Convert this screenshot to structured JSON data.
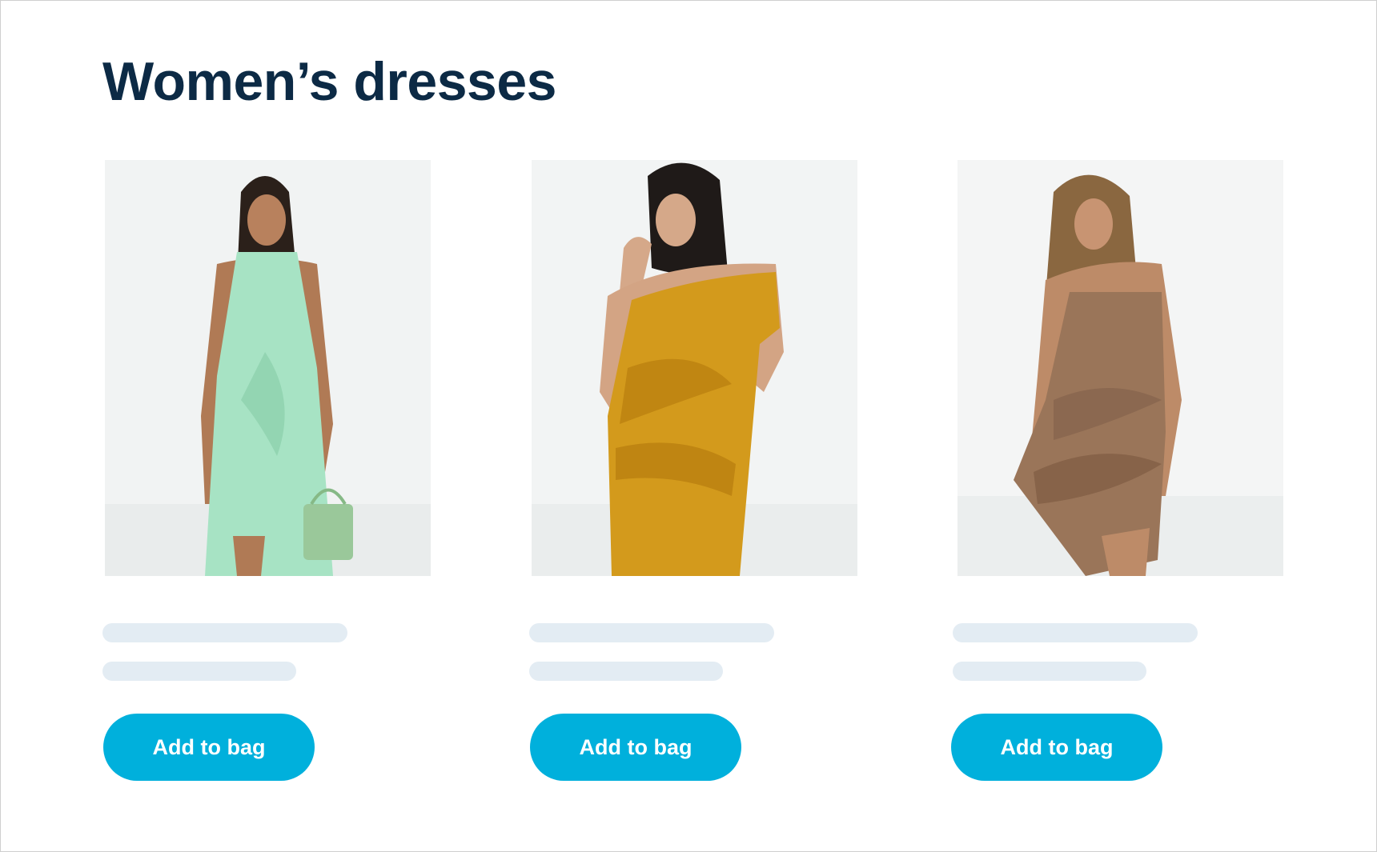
{
  "page": {
    "title": "Women’s dresses"
  },
  "products": [
    {
      "image_desc": "model-in-mint-halter-dress",
      "dress_color": "#a7e3c4",
      "button_label": "Add to bag"
    },
    {
      "image_desc": "model-in-mustard-velvet-dress",
      "dress_color": "#d39a1c",
      "button_label": "Add to bag"
    },
    {
      "image_desc": "model-in-brown-ruched-dress",
      "dress_color": "#9a7559",
      "button_label": "Add to bag"
    }
  ],
  "colors": {
    "title": "#0c2a45",
    "button": "#00b0dc",
    "skeleton": "#e3ecf3"
  }
}
